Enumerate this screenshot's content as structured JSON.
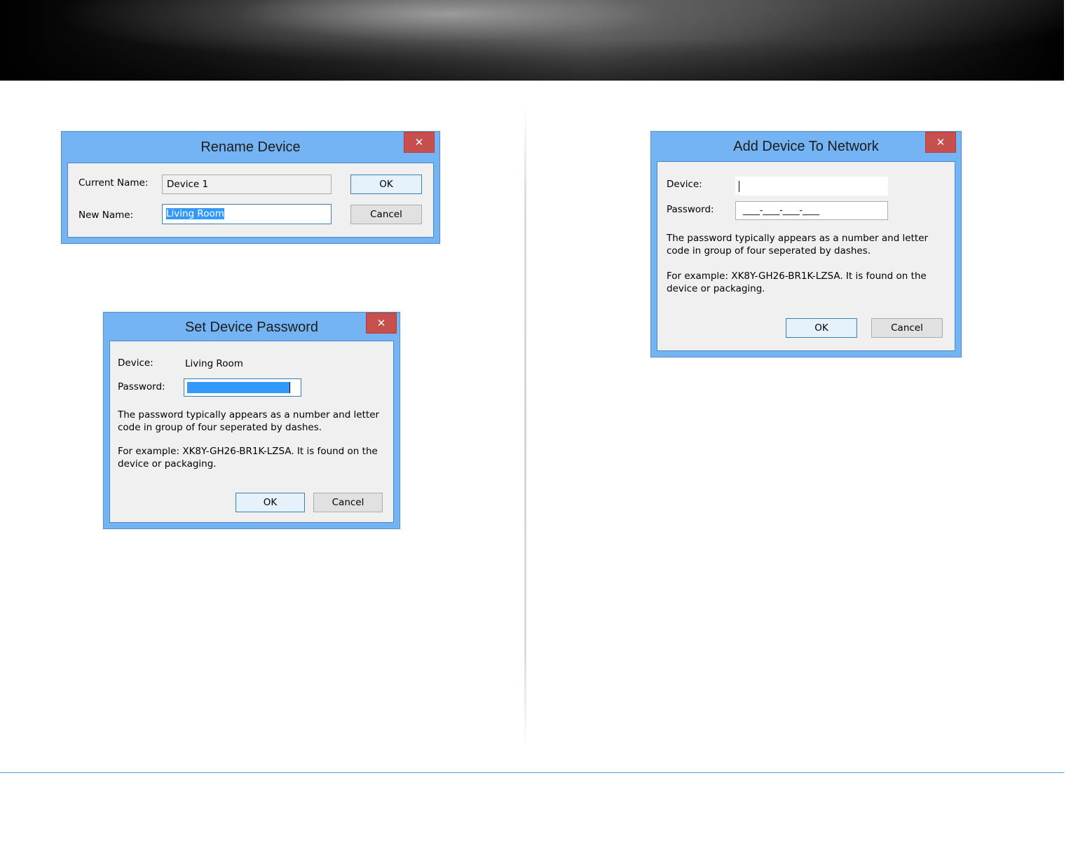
{
  "rename_dialog": {
    "title": "Rename Device",
    "close_glyph": "✕",
    "current_name_label": "Current Name:",
    "current_name_value": "Device 1",
    "new_name_label": "New Name:",
    "new_name_value": "Living Room",
    "ok_label": "OK",
    "cancel_label": "Cancel"
  },
  "set_password_dialog": {
    "title": "Set Device Password",
    "close_glyph": "✕",
    "device_label": "Device:",
    "device_value": "Living Room",
    "password_label": "Password:",
    "password_mask": "____-____-____-____",
    "help_line1": "The password typically appears as a number and letter",
    "help_line2": "code in group of four seperated by dashes.",
    "example_line1": "For example: XK8Y-GH26-BR1K-LZSA. It is found on the",
    "example_line2": "device or packaging.",
    "ok_label": "OK",
    "cancel_label": "Cancel"
  },
  "add_device_dialog": {
    "title": "Add Device To Network",
    "close_glyph": "✕",
    "device_label": "Device:",
    "device_value": "",
    "password_label": "Password:",
    "password_mask": "____-____-____-____",
    "help_line1": "The password typically appears as a number and letter",
    "help_line2": "code in group of four seperated by dashes.",
    "example_line1": "For example: XK8Y-GH26-BR1K-LZSA. It is found on the",
    "example_line2": "device or packaging.",
    "ok_label": "OK",
    "cancel_label": "Cancel"
  },
  "colors": {
    "window_frame": "#74b4f4",
    "close_button": "#c7504f",
    "selection": "#3399ff",
    "footer_rule": "#5b9bd5"
  }
}
